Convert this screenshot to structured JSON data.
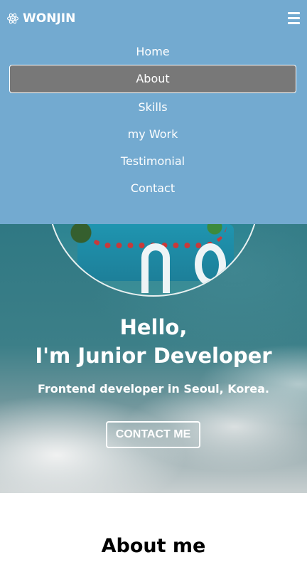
{
  "brand": {
    "name": "WONJIN",
    "icon": "react-atom-icon"
  },
  "nav": {
    "toggle_icon": "hamburger-menu-icon",
    "items": [
      {
        "label": "Home"
      },
      {
        "label": "About",
        "active": true
      },
      {
        "label": "Skills"
      },
      {
        "label": "my Work"
      },
      {
        "label": "Testimonial"
      },
      {
        "label": "Contact"
      }
    ]
  },
  "hero": {
    "title_line1": "Hello,",
    "title_line2": "I'm Junior Developer",
    "subtitle": "Frontend developer in Seoul, Korea.",
    "contact_button": "CONTACT ME"
  },
  "about": {
    "title": "About me"
  },
  "colors": {
    "navbar_bg": "#73aad0",
    "active_item_bg": "#787878",
    "hero_teal": "#2f7f8a"
  }
}
